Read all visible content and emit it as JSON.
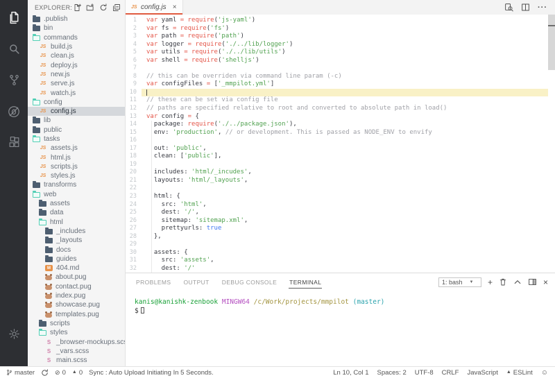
{
  "colors": {
    "accent_tab": "#e05a3f",
    "activity_bar_bg": "#2d2f33",
    "sidebar_bg": "#f5f5f5",
    "selection_bg": "#d5d8dc",
    "line_highlight": "#f9f1c6",
    "keyword": "#e45649",
    "string": "#50a14f",
    "comment": "#a0a1a7",
    "boolean": "#4078f2",
    "folder_open": "#53cfb5",
    "js_icon": "#e8934a"
  },
  "activity_bar": {
    "items": [
      {
        "icon": "files",
        "active": true
      },
      {
        "icon": "search",
        "active": false
      },
      {
        "icon": "source-control",
        "active": false
      },
      {
        "icon": "debug",
        "active": false
      },
      {
        "icon": "extensions",
        "active": false
      }
    ],
    "bottom": [
      {
        "icon": "settings-gear"
      }
    ]
  },
  "sidebar": {
    "title": "EXPLORER: M...",
    "actions": [
      "new-file",
      "new-folder",
      "refresh",
      "collapse-all"
    ],
    "tree": [
      {
        "label": ".publish",
        "icon": "folder",
        "level": 0
      },
      {
        "label": "bin",
        "icon": "folder",
        "level": 0
      },
      {
        "label": "commands",
        "icon": "folder-open",
        "level": 0
      },
      {
        "label": "build.js",
        "icon": "js",
        "level": 1
      },
      {
        "label": "clean.js",
        "icon": "js",
        "level": 1
      },
      {
        "label": "deploy.js",
        "icon": "js",
        "level": 1
      },
      {
        "label": "new.js",
        "icon": "js",
        "level": 1
      },
      {
        "label": "serve.js",
        "icon": "js",
        "level": 1
      },
      {
        "label": "watch.js",
        "icon": "js",
        "level": 1
      },
      {
        "label": "config",
        "icon": "folder-open",
        "level": 0
      },
      {
        "label": "config.js",
        "icon": "js",
        "level": 1,
        "selected": true
      },
      {
        "label": "lib",
        "icon": "folder",
        "level": 0
      },
      {
        "label": "public",
        "icon": "folder",
        "level": 0
      },
      {
        "label": "tasks",
        "icon": "folder-open",
        "level": 0
      },
      {
        "label": "assets.js",
        "icon": "js",
        "level": 1
      },
      {
        "label": "html.js",
        "icon": "js",
        "level": 1
      },
      {
        "label": "scripts.js",
        "icon": "js",
        "level": 1
      },
      {
        "label": "styles.js",
        "icon": "js",
        "level": 1
      },
      {
        "label": "transforms",
        "icon": "folder",
        "level": 0
      },
      {
        "label": "web",
        "icon": "folder-open",
        "level": 0
      },
      {
        "label": "assets",
        "icon": "folder",
        "level": 1
      },
      {
        "label": "data",
        "icon": "folder",
        "level": 1
      },
      {
        "label": "html",
        "icon": "folder-open",
        "level": 1
      },
      {
        "label": "_includes",
        "icon": "folder",
        "level": 2
      },
      {
        "label": "_layouts",
        "icon": "folder",
        "level": 2
      },
      {
        "label": "docs",
        "icon": "folder",
        "level": 2
      },
      {
        "label": "guides",
        "icon": "folder",
        "level": 2
      },
      {
        "label": "404.md",
        "icon": "md",
        "level": 2
      },
      {
        "label": "about.pug",
        "icon": "pug",
        "level": 2
      },
      {
        "label": "contact.pug",
        "icon": "pug",
        "level": 2
      },
      {
        "label": "index.pug",
        "icon": "pug",
        "level": 2
      },
      {
        "label": "showcase.pug",
        "icon": "pug",
        "level": 2
      },
      {
        "label": "templates.pug",
        "icon": "pug",
        "level": 2
      },
      {
        "label": "scripts",
        "icon": "folder",
        "level": 1
      },
      {
        "label": "styles",
        "icon": "folder-open",
        "level": 1
      },
      {
        "label": "_browser-mockups.scss",
        "icon": "scss",
        "level": 2
      },
      {
        "label": "_vars.scss",
        "icon": "scss",
        "level": 2
      },
      {
        "label": "main.scss",
        "icon": "scss",
        "level": 2
      }
    ]
  },
  "editor": {
    "tabs": [
      {
        "label": "config.js",
        "badge": "JS",
        "close": "×",
        "active": true
      }
    ],
    "actions": [
      {
        "icon": "open-preview"
      },
      {
        "icon": "split-editor"
      },
      {
        "icon": "more-actions"
      }
    ],
    "code": {
      "current_line": 10,
      "lines": [
        {
          "n": 1,
          "t": [
            [
              "k",
              "var"
            ],
            [
              "i",
              " yaml "
            ],
            [
              "o",
              "="
            ],
            [
              "i",
              " "
            ],
            [
              "k",
              "require"
            ],
            [
              "p",
              "("
            ],
            [
              "s",
              "'js-yaml'"
            ],
            [
              "p",
              ")"
            ]
          ]
        },
        {
          "n": 2,
          "t": [
            [
              "k",
              "var"
            ],
            [
              "i",
              " fs "
            ],
            [
              "o",
              "="
            ],
            [
              "i",
              " "
            ],
            [
              "k",
              "require"
            ],
            [
              "p",
              "("
            ],
            [
              "s",
              "'fs'"
            ],
            [
              "p",
              ")"
            ]
          ]
        },
        {
          "n": 3,
          "t": [
            [
              "k",
              "var"
            ],
            [
              "i",
              " path "
            ],
            [
              "o",
              "="
            ],
            [
              "i",
              " "
            ],
            [
              "k",
              "require"
            ],
            [
              "p",
              "("
            ],
            [
              "s",
              "'path'"
            ],
            [
              "p",
              ")"
            ]
          ]
        },
        {
          "n": 4,
          "t": [
            [
              "k",
              "var"
            ],
            [
              "i",
              " logger "
            ],
            [
              "o",
              "="
            ],
            [
              "i",
              " "
            ],
            [
              "k",
              "require"
            ],
            [
              "p",
              "("
            ],
            [
              "s",
              "'./../lib/logger'"
            ],
            [
              "p",
              ")"
            ]
          ]
        },
        {
          "n": 5,
          "t": [
            [
              "k",
              "var"
            ],
            [
              "i",
              " utils "
            ],
            [
              "o",
              "="
            ],
            [
              "i",
              " "
            ],
            [
              "k",
              "require"
            ],
            [
              "p",
              "("
            ],
            [
              "s",
              "'./../lib/utils'"
            ],
            [
              "p",
              ")"
            ]
          ]
        },
        {
          "n": 6,
          "t": [
            [
              "k",
              "var"
            ],
            [
              "i",
              " shell "
            ],
            [
              "o",
              "="
            ],
            [
              "i",
              " "
            ],
            [
              "k",
              "require"
            ],
            [
              "p",
              "("
            ],
            [
              "s",
              "'shelljs'"
            ],
            [
              "p",
              ")"
            ]
          ]
        },
        {
          "n": 7,
          "t": []
        },
        {
          "n": 8,
          "t": [
            [
              "c",
              "// this can be overriden via command line param (-c)"
            ]
          ]
        },
        {
          "n": 9,
          "t": [
            [
              "k",
              "var"
            ],
            [
              "i",
              " configFiles "
            ],
            [
              "o",
              "="
            ],
            [
              "i",
              " "
            ],
            [
              "p",
              "["
            ],
            [
              "s",
              "'_mmpilot.yml'"
            ],
            [
              "p",
              "]"
            ]
          ]
        },
        {
          "n": 10,
          "t": []
        },
        {
          "n": 11,
          "t": [
            [
              "c",
              "// these can be set via config file"
            ]
          ]
        },
        {
          "n": 12,
          "t": [
            [
              "c",
              "// paths are specified relative to root and converted to absolute path in load()"
            ]
          ]
        },
        {
          "n": 13,
          "t": [
            [
              "k",
              "var"
            ],
            [
              "i",
              " config "
            ],
            [
              "o",
              "="
            ],
            [
              "i",
              " "
            ],
            [
              "p",
              "{"
            ]
          ]
        },
        {
          "n": 14,
          "t": [
            [
              "i",
              "  package"
            ],
            [
              "p",
              ": "
            ],
            [
              "k",
              "require"
            ],
            [
              "p",
              "("
            ],
            [
              "s",
              "'./../package.json'"
            ],
            [
              "p",
              "),"
            ]
          ]
        },
        {
          "n": 15,
          "t": [
            [
              "i",
              "  env"
            ],
            [
              "p",
              ": "
            ],
            [
              "s",
              "'production'"
            ],
            [
              "p",
              ", "
            ],
            [
              "c",
              "// or development. This is passed as NODE_ENV to envify"
            ]
          ]
        },
        {
          "n": 16,
          "t": []
        },
        {
          "n": 17,
          "t": [
            [
              "i",
              "  out"
            ],
            [
              "p",
              ": "
            ],
            [
              "s",
              "'public'"
            ],
            [
              "p",
              ","
            ]
          ]
        },
        {
          "n": 18,
          "t": [
            [
              "i",
              "  clean"
            ],
            [
              "p",
              ": ["
            ],
            [
              "s",
              "'public'"
            ],
            [
              "p",
              "],"
            ]
          ]
        },
        {
          "n": 19,
          "t": []
        },
        {
          "n": 20,
          "t": [
            [
              "i",
              "  includes"
            ],
            [
              "p",
              ": "
            ],
            [
              "s",
              "'html/_incudes'"
            ],
            [
              "p",
              ","
            ]
          ]
        },
        {
          "n": 21,
          "t": [
            [
              "i",
              "  layouts"
            ],
            [
              "p",
              ": "
            ],
            [
              "s",
              "'html/_layouts'"
            ],
            [
              "p",
              ","
            ]
          ]
        },
        {
          "n": 22,
          "t": []
        },
        {
          "n": 23,
          "t": [
            [
              "i",
              "  html"
            ],
            [
              "p",
              ": {"
            ]
          ]
        },
        {
          "n": 24,
          "t": [
            [
              "i",
              "    src"
            ],
            [
              "p",
              ": "
            ],
            [
              "s",
              "'html'"
            ],
            [
              "p",
              ","
            ]
          ]
        },
        {
          "n": 25,
          "t": [
            [
              "i",
              "    dest"
            ],
            [
              "p",
              ": "
            ],
            [
              "s",
              "'/'"
            ],
            [
              "p",
              ","
            ]
          ]
        },
        {
          "n": 26,
          "t": [
            [
              "i",
              "    sitemap"
            ],
            [
              "p",
              ": "
            ],
            [
              "s",
              "'sitemap.xml'"
            ],
            [
              "p",
              ","
            ]
          ]
        },
        {
          "n": 27,
          "t": [
            [
              "i",
              "    prettyurls"
            ],
            [
              "p",
              ": "
            ],
            [
              "b",
              "true"
            ]
          ]
        },
        {
          "n": 28,
          "t": [
            [
              "p",
              "  },"
            ]
          ]
        },
        {
          "n": 29,
          "t": []
        },
        {
          "n": 30,
          "t": [
            [
              "i",
              "  assets"
            ],
            [
              "p",
              ": {"
            ]
          ]
        },
        {
          "n": 31,
          "t": [
            [
              "i",
              "    src"
            ],
            [
              "p",
              ": "
            ],
            [
              "s",
              "'assets'"
            ],
            [
              "p",
              ","
            ]
          ]
        },
        {
          "n": 32,
          "t": [
            [
              "i",
              "    dest"
            ],
            [
              "p",
              ": "
            ],
            [
              "s",
              "'/'"
            ]
          ]
        }
      ]
    }
  },
  "panel": {
    "tabs": [
      {
        "label": "PROBLEMS",
        "active": false
      },
      {
        "label": "OUTPUT",
        "active": false
      },
      {
        "label": "DEBUG CONSOLE",
        "active": false
      },
      {
        "label": "TERMINAL",
        "active": true
      }
    ],
    "terminal_select": "1: bash",
    "actions": [
      {
        "icon": "new-terminal",
        "glyph": "+"
      },
      {
        "icon": "kill-terminal"
      },
      {
        "icon": "maximize-panel"
      },
      {
        "icon": "split-terminal"
      },
      {
        "icon": "close-panel",
        "glyph": "×"
      }
    ],
    "terminal": {
      "prompt_tokens": [
        [
          "tg",
          "kanis@kanishk-zenbook"
        ],
        [
          "tp",
          " "
        ],
        [
          "tm",
          "MINGW64"
        ],
        [
          "tp",
          " "
        ],
        [
          "ty",
          "/c/Work/projects/mmpilot"
        ],
        [
          "tp",
          " "
        ],
        [
          "tc",
          "(master)"
        ]
      ],
      "prompt_char": "$"
    }
  },
  "status_bar": {
    "left": [
      {
        "icon": "git-branch",
        "label": "master"
      },
      {
        "icon": "sync",
        "label": ""
      },
      {
        "icon": "error",
        "label": "0"
      },
      {
        "icon": "warning",
        "label": "0"
      },
      {
        "label": "Sync : Auto Upload Initiating In 5 Seconds."
      }
    ],
    "right": [
      {
        "label": "Ln 10, Col 1"
      },
      {
        "label": "Spaces: 2"
      },
      {
        "label": "UTF-8"
      },
      {
        "label": "CRLF"
      },
      {
        "label": "JavaScript"
      },
      {
        "icon": "warning",
        "label": "ESLint"
      },
      {
        "icon": "smiley",
        "label": ""
      }
    ]
  }
}
